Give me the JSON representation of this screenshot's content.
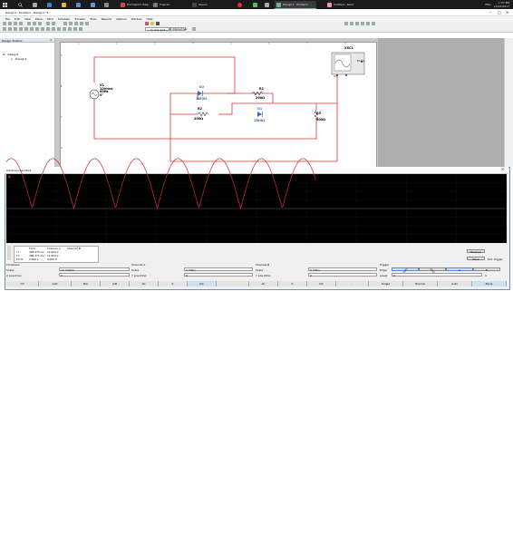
{
  "taskbar": {
    "apps": [
      {
        "label": "Homework Help - ..."
      },
      {
        "label": "Friends"
      },
      {
        "label": "Steam"
      },
      {
        "label": "Design1 - Multisim ..."
      },
      {
        "label": "Untitled - Paint"
      }
    ],
    "tray_lang": "ENG",
    "clock_time": "1:37 PM",
    "clock_date": "10/14/2017"
  },
  "window": {
    "title": "Design1 - Multisim - Design1 *1"
  },
  "menu": [
    "File",
    "Edit",
    "View",
    "Place",
    "MCU",
    "Simulate",
    "Transfer",
    "Tools",
    "Reports",
    "Options",
    "Window",
    "Help"
  ],
  "toolbar": {
    "in_use_list": "--- In-Use List ---",
    "interactive_label": "Interactive"
  },
  "design_toolbox": {
    "title": "Design Toolbox",
    "root": "Design1",
    "child": "Design1"
  },
  "schematic": {
    "col_markers": [
      "1",
      "2",
      "3",
      "4",
      "5",
      "6",
      "7",
      "8"
    ],
    "row_markers": [
      "A",
      "B",
      "C",
      "D"
    ],
    "source": {
      "name": "V1",
      "line1": "12Vrms",
      "line2": "60Hz",
      "line3": "0°"
    },
    "d2": {
      "name": "D2",
      "model": "1BH62"
    },
    "d1": {
      "name": "D1",
      "model": "1BH62"
    },
    "r1": {
      "name": "R1",
      "value": "200Ω"
    },
    "r2": {
      "name": "R2",
      "value": "200Ω"
    },
    "r3": {
      "name": "R3",
      "value": "500Ω"
    },
    "xsc": {
      "name": "XSC1",
      "ext_trig": "Ext Trig",
      "ch_a": "A",
      "ch_b": "B"
    }
  },
  "oscilloscope": {
    "title": "Oscilloscope-XSC1",
    "readout": {
      "headers": [
        "",
        "Time",
        "Channel_A",
        "Channel_B"
      ],
      "rows": [
        {
          "label": "T1",
          "time": "499.473 ms",
          "cha": "11.604 V",
          "chb": ""
        },
        {
          "label": "T2",
          "time": "499.473 ms",
          "cha": "11.604 V",
          "chb": ""
        },
        {
          "label": "T2-T1",
          "time": "0.000 s",
          "cha": "0.000 V",
          "chb": ""
        }
      ]
    },
    "buttons": {
      "reverse": "Reverse",
      "save": "Save",
      "ext_trigger": "Ext. trigger"
    },
    "timebase": {
      "section": "Timebase",
      "scale_label": "Scale:",
      "scale": "10 ms/Div",
      "xpos_label": "X pos.(Div):",
      "xpos": "0"
    },
    "channel_a": {
      "section": "Channel A",
      "scale_label": "Scale:",
      "scale": "2 V/Div",
      "ypos_label": "Y pos.(Div):",
      "ypos": "0"
    },
    "channel_b": {
      "section": "Channel B",
      "scale_label": "Scale:",
      "scale": "5 V/Div",
      "ypos_label": "Y pos.(Div):",
      "ypos": "0"
    },
    "trigger": {
      "section": "Trigger",
      "edge_label": "Edge:",
      "level_label": "Level:",
      "level": "0",
      "level_unit": "V"
    },
    "bottom_buttons": [
      "Y/T",
      "Add",
      "B/A",
      "A/B",
      "AC",
      "0",
      "DC",
      "",
      "AC",
      "0",
      "DC",
      "-",
      "Single",
      "Normal",
      "Auto",
      "None"
    ]
  },
  "colors": {
    "wire": "#e03030",
    "trace": "#d42a2a",
    "accent": "#3a6fb7"
  }
}
